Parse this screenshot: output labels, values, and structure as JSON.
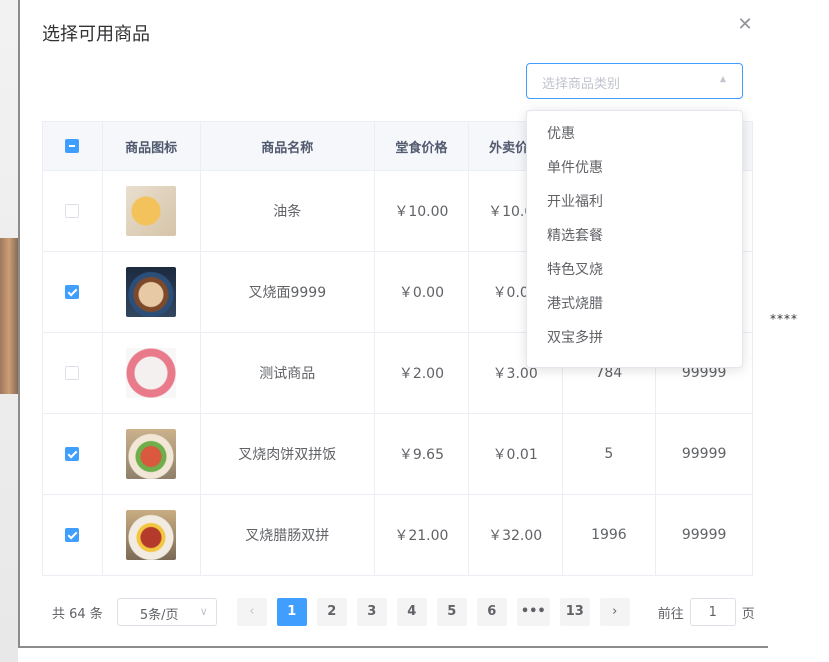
{
  "dialog": {
    "title": "选择可用商品",
    "close_icon": "close-icon"
  },
  "category_select": {
    "placeholder": "选择商品类别",
    "options": [
      "优惠",
      "单件优惠",
      "开业福利",
      "精选套餐",
      "特色叉烧",
      "港式烧腊",
      "双宝多拼"
    ]
  },
  "table": {
    "headers": [
      "",
      "商品图标",
      "商品名称",
      "堂食价格",
      "外卖价格",
      "",
      ""
    ],
    "rows": [
      {
        "checked": false,
        "name": "油条",
        "dine_price": "￥10.00",
        "takeout_price": "￥10.00",
        "col5": "",
        "col6": ""
      },
      {
        "checked": true,
        "name": "叉烧面9999",
        "dine_price": "￥0.00",
        "takeout_price": "￥0.00",
        "col5": "",
        "col6": ""
      },
      {
        "checked": false,
        "name": "测试商品",
        "dine_price": "￥2.00",
        "takeout_price": "￥3.00",
        "col5": "784",
        "col6": "99999"
      },
      {
        "checked": true,
        "name": "叉烧肉饼双拼饭",
        "dine_price": "￥9.65",
        "takeout_price": "￥0.01",
        "col5": "5",
        "col6": "99999"
      },
      {
        "checked": true,
        "name": "叉烧腊肠双拼",
        "dine_price": "￥21.00",
        "takeout_price": "￥32.00",
        "col5": "1996",
        "col6": "99999"
      }
    ]
  },
  "pagination": {
    "total": "共 64 条",
    "page_size": "5条/页",
    "pages": [
      "1",
      "2",
      "3",
      "4",
      "5",
      "6",
      "•••",
      "13"
    ],
    "current": "1",
    "goto_prefix": "前往",
    "goto_value": "1",
    "goto_suffix": "页"
  },
  "background": {
    "stars": "****"
  },
  "colors": {
    "primary": "#409eff",
    "border": "#ebeef5"
  }
}
